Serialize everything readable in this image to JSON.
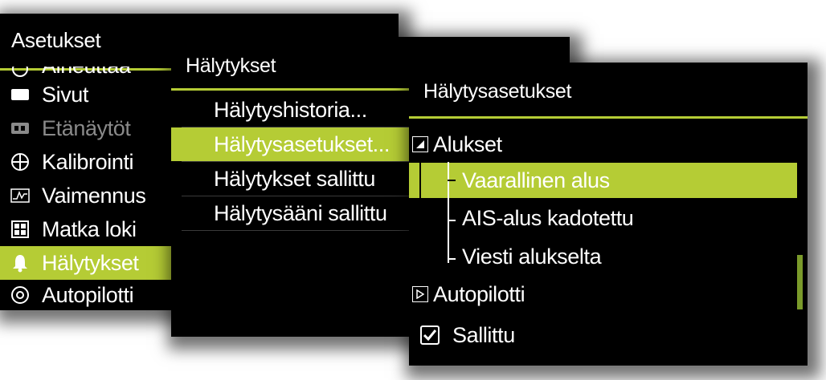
{
  "accent_color": "#b5cc35",
  "settings_panel": {
    "title": "Asetukset",
    "cut_item": "Aiheuttaa",
    "items": [
      {
        "label": "Sivut",
        "icon": "display-icon",
        "dim": false
      },
      {
        "label": "Etänäytöt",
        "icon": "remote-display-icon",
        "dim": true
      },
      {
        "label": "Kalibrointi",
        "icon": "crosshair-icon",
        "dim": false
      },
      {
        "label": "Vaimennus",
        "icon": "waveform-icon",
        "dim": false
      },
      {
        "label": "Matka loki",
        "icon": "trip-log-icon",
        "dim": false
      },
      {
        "label": "Hälytykset",
        "icon": "bell-icon",
        "dim": false,
        "selected": true
      },
      {
        "label": "Autopilotti",
        "icon": "autopilot-icon",
        "dim": false
      }
    ]
  },
  "alarms_panel": {
    "title": "Hälytykset",
    "items": [
      {
        "label": "Hälytyshistoria..."
      },
      {
        "label": "Hälytysasetukset...",
        "selected": true
      },
      {
        "label": "Hälytykset sallittu"
      },
      {
        "label": "Hälytysääni sallittu"
      }
    ]
  },
  "alarm_settings_panel": {
    "title": "Hälytysasetukset",
    "group_vessels": "Alukset",
    "children": [
      {
        "label": "Vaarallinen alus",
        "selected": true
      },
      {
        "label": "AIS-alus kadotettu"
      },
      {
        "label": "Viesti alukselta"
      }
    ],
    "group_autopilot": "Autopilotti",
    "enabled_label": "Sallittu",
    "enabled_checked": true
  }
}
